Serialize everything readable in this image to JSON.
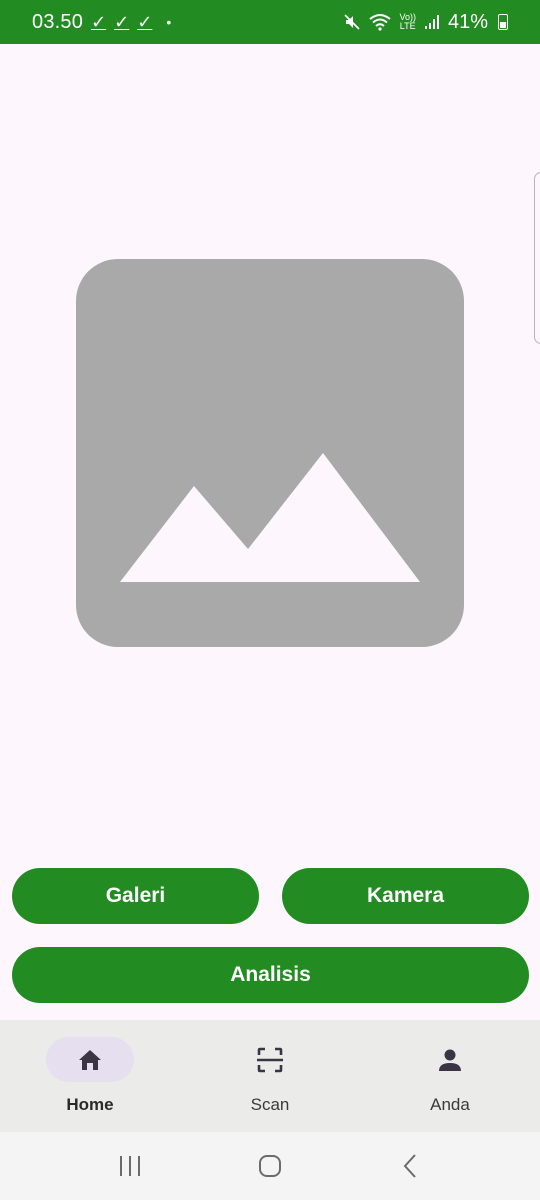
{
  "status_bar": {
    "time": "03.50",
    "check_marks": [
      "✓",
      "✓",
      "✓"
    ],
    "dot": "•",
    "volte_label": "Vo))",
    "lte_label": "LTE",
    "battery": "41%",
    "background_color": "#228b22"
  },
  "image_placeholder": {
    "icon": "image-placeholder-icon",
    "background_color": "#a9a9a9"
  },
  "buttons": {
    "galeri": "Galeri",
    "kamera": "Kamera",
    "analisis": "Analisis",
    "color": "#228b22"
  },
  "bottom_nav": {
    "items": [
      {
        "label": "Home",
        "icon": "home-icon",
        "active": true
      },
      {
        "label": "Scan",
        "icon": "scan-icon",
        "active": false
      },
      {
        "label": "Anda",
        "icon": "person-icon",
        "active": false
      }
    ]
  },
  "system_nav": {
    "recent": "recent-apps-icon",
    "home": "home-circle-icon",
    "back": "back-icon"
  }
}
